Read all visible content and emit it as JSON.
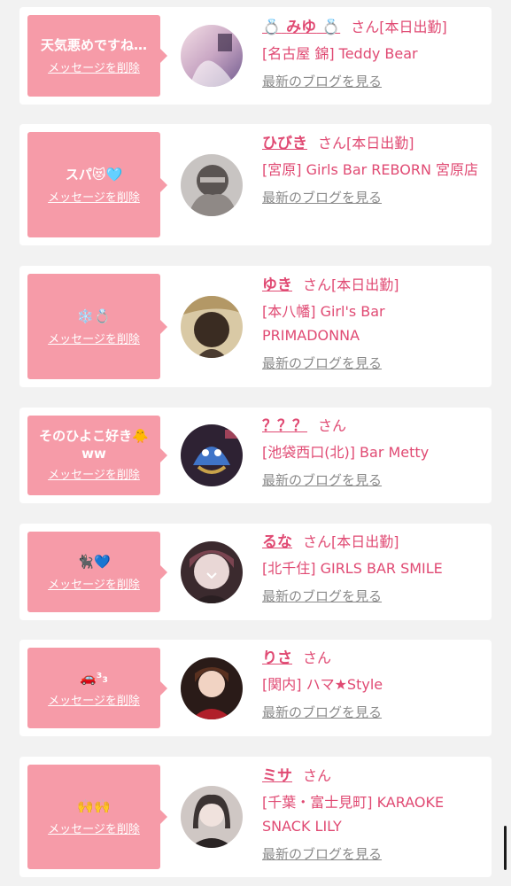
{
  "entries": [
    {
      "message": "天気悪めですね…",
      "delete_label": "メッセージを削除",
      "name": "みゆ",
      "name_prefix": "💍",
      "name_suffix": "💍",
      "honorific": "さん",
      "status": "[本日出勤]",
      "shop": "[名古屋 錦] Teddy Bear",
      "blog_label": "最新のブログを見る"
    },
    {
      "message": "スパ😻🩵",
      "delete_label": "メッセージを削除",
      "name": "ひびき",
      "honorific": "さん",
      "status": "[本日出勤]",
      "shop": "[宮原] Girls Bar REBORN 宮原店",
      "blog_label": "最新のブログを見る"
    },
    {
      "message": "❄️💍",
      "delete_label": "メッセージを削除",
      "name": "ゆき",
      "honorific": "さん",
      "status": "[本日出勤]",
      "shop": "[本八幡] Girl's Bar PRIMADONNA",
      "blog_label": "最新のブログを見る"
    },
    {
      "message": "そのひよこ好き🐥ww",
      "delete_label": "メッセージを削除",
      "name": "？？？",
      "honorific": "さん",
      "status": "",
      "shop": "[池袋西口(北)] Bar Metty",
      "blog_label": "最新のブログを見る"
    },
    {
      "message": "🐈‍⬛💙",
      "delete_label": "メッセージを削除",
      "name": "るな",
      "honorific": "さん",
      "status": "[本日出勤]",
      "shop": "[北千住] GIRLS BAR SMILE",
      "blog_label": "最新のブログを見る"
    },
    {
      "message": "🚗³₃",
      "delete_label": "メッセージを削除",
      "name": "りさ",
      "honorific": "さん",
      "status": "",
      "shop": "[関内] ハマ★Style",
      "blog_label": "最新のブログを見る"
    },
    {
      "message": "🙌🙌",
      "delete_label": "メッセージを削除",
      "name": "ミサ",
      "honorific": "さん",
      "status": "",
      "shop": "[千葉・富士見町] KARAOKE SNACK LILY",
      "blog_label": "最新のブログを見る"
    }
  ],
  "colors": {
    "accent": "#e04a73",
    "bubble": "#f69ba8",
    "background": "#f2f2f2"
  }
}
